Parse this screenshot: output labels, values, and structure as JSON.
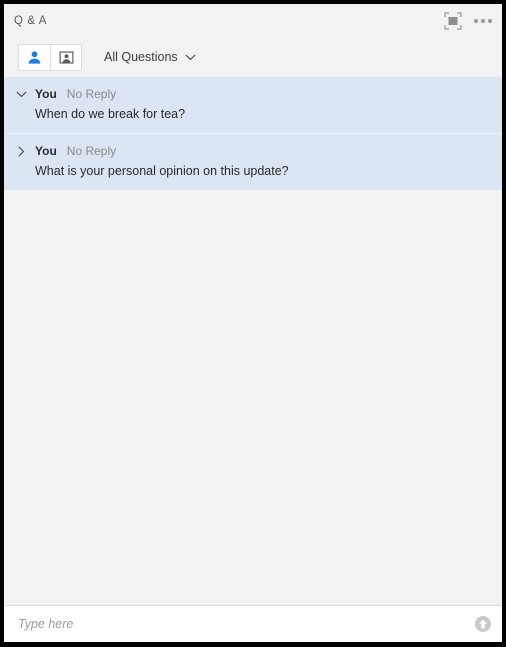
{
  "window": {
    "title": "Q & A"
  },
  "titlebar": {
    "popout_icon": "popout-expand-icon",
    "more_icon": "more-options-icon"
  },
  "toolbar": {
    "buttons": [
      {
        "icon": "attendee-person-icon",
        "label": "Attendees",
        "selected": true
      },
      {
        "icon": "presenter-person-icon",
        "label": "Presenters",
        "selected": false
      }
    ],
    "filter": {
      "label": "All Questions",
      "icon": "chevron-down-icon"
    }
  },
  "questions": [
    {
      "author": "You",
      "status": "No Reply",
      "text": "When do we break for tea?",
      "expanded": true,
      "chevron": "chevron-down-icon"
    },
    {
      "author": "You",
      "status": "No Reply",
      "text": "What is your personal opinion on this update?",
      "expanded": false,
      "chevron": "chevron-right-icon"
    }
  ],
  "composer": {
    "value": "",
    "placeholder": "Type here",
    "send_icon": "send-up-arrow-icon"
  },
  "colors": {
    "accent": "#1f7fe0",
    "row_highlight": "#dbe5f3",
    "panel_bg": "#f2f2f2",
    "frame": "#000000"
  }
}
